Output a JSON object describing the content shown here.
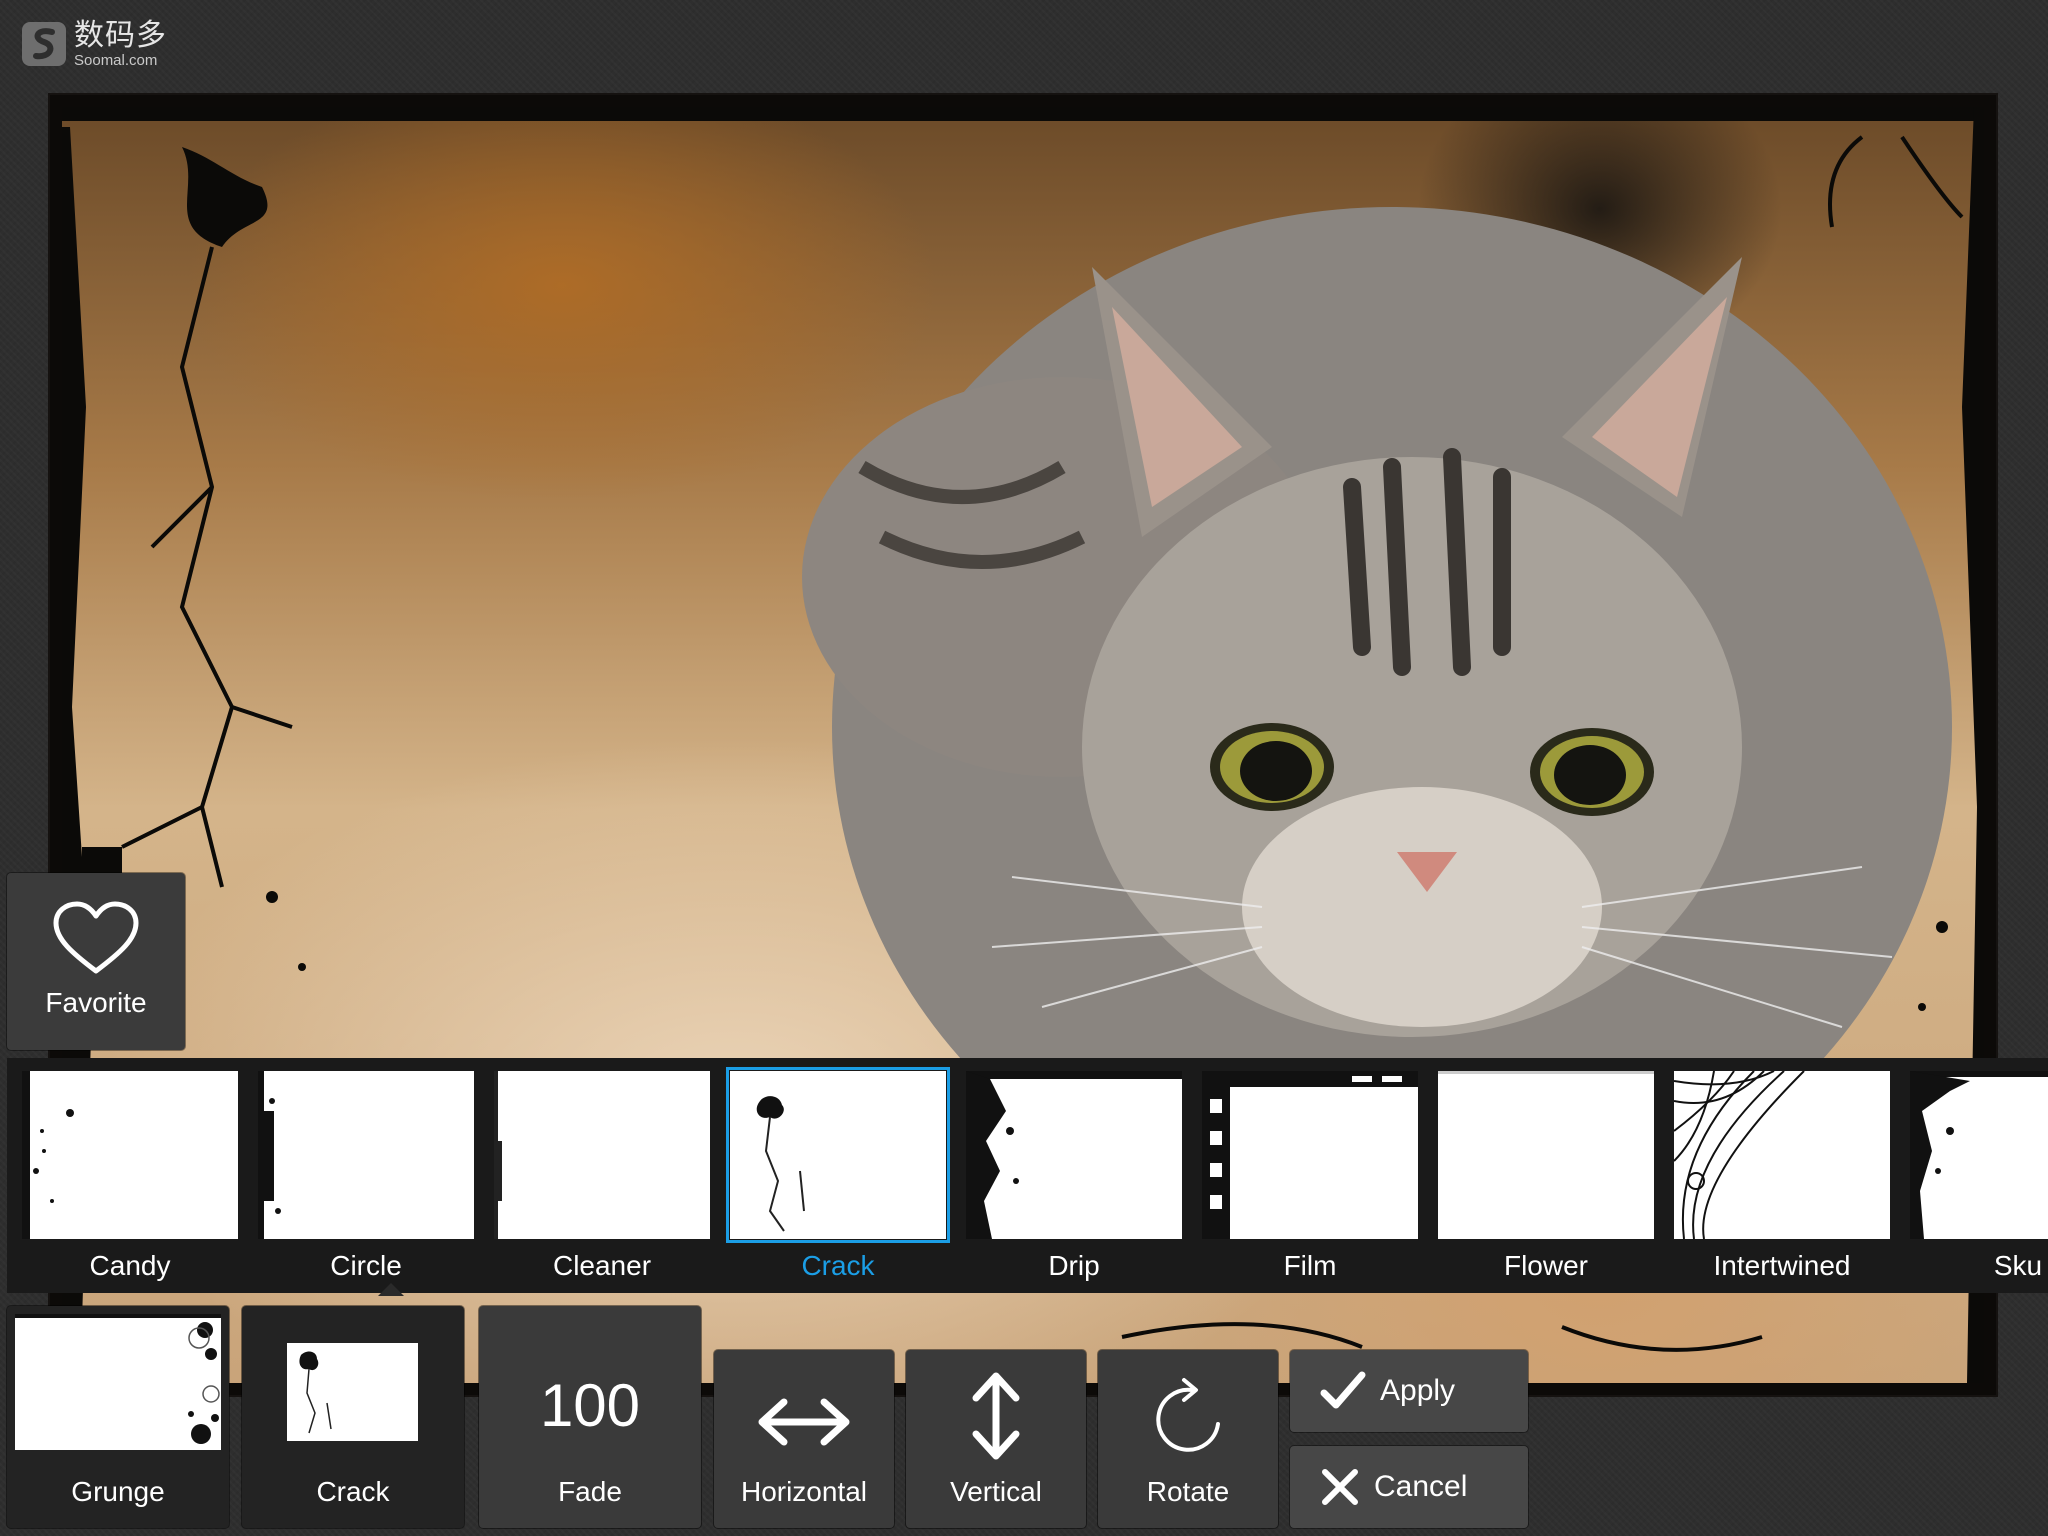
{
  "watermark": {
    "cn": "数码多",
    "en": "Soomal.com"
  },
  "favorite": {
    "label": "Favorite",
    "icon": "heart-icon"
  },
  "frames": [
    {
      "label": "Candy",
      "selected": false
    },
    {
      "label": "Circle",
      "selected": false
    },
    {
      "label": "Cleaner",
      "selected": false
    },
    {
      "label": "Crack",
      "selected": true
    },
    {
      "label": "Drip",
      "selected": false
    },
    {
      "label": "Film",
      "selected": false
    },
    {
      "label": "Flower",
      "selected": false
    },
    {
      "label": "Intertwined",
      "selected": false
    },
    {
      "label": "Sku",
      "selected": false
    }
  ],
  "tools": {
    "category": "Grunge",
    "current_frame": "Crack",
    "fade": {
      "value": "100",
      "label": "Fade"
    },
    "horizontal": "Horizontal",
    "vertical": "Vertical",
    "rotate": "Rotate",
    "apply": "Apply",
    "cancel": "Cancel"
  },
  "colors": {
    "accent": "#1b9ee6",
    "panel": "#3a3a3a",
    "background": "#2e2e2e"
  }
}
